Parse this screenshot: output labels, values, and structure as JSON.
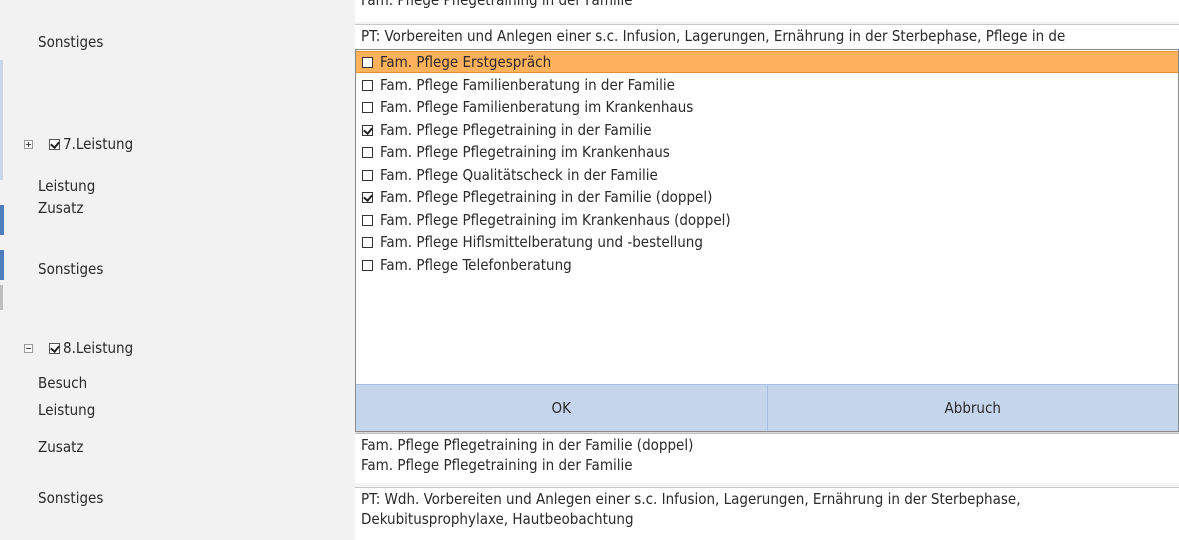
{
  "form": {
    "top_field_cut": "Fam. Pflege Pflegetraining in der Familie",
    "sonstiges_label": "Sonstiges",
    "sonstiges_prev_value": "PT: Vorbereiten und  Anlegen einer s.c. Infusion, Lagerungen, Ernährung in der Sterbephase, Pflege in de",
    "section7": {
      "title": "7.Leistung",
      "expander": "+",
      "checked": true,
      "leistung_label": "Leistung",
      "zusatz_label": "Zusatz",
      "sonstiges_label": "Sonstiges"
    },
    "section8": {
      "title": "8.Leistung",
      "expander": "-",
      "checked": true,
      "besuch_label": "Besuch",
      "leistung_label": "Leistung",
      "zusatz_label": "Zusatz",
      "zusatz_value_1": "Fam. Pflege Pflegetraining in der Familie (doppel)",
      "zusatz_value_2": "Fam. Pflege Pflegetraining in der Familie",
      "sonstiges_label": "Sonstiges",
      "sonstiges_value_1": "PT: Wdh. Vorbereiten und  Anlegen einer s.c. Infusion, Lagerungen, Ernährung in der Sterbephase,",
      "sonstiges_value_2": "Dekubitusprophylaxe, Hautbeobachtung"
    }
  },
  "popup": {
    "options": [
      {
        "label": "Fam. Pflege Erstgespräch",
        "checked": false,
        "highlighted": true
      },
      {
        "label": "Fam. Pflege Familienberatung in der Familie",
        "checked": false,
        "highlighted": false
      },
      {
        "label": "Fam. Pflege Familienberatung im Krankenhaus",
        "checked": false,
        "highlighted": false
      },
      {
        "label": "Fam. Pflege Pflegetraining in der Familie",
        "checked": true,
        "highlighted": false
      },
      {
        "label": "Fam. Pflege Pflegetraining im Krankenhaus",
        "checked": false,
        "highlighted": false
      },
      {
        "label": "Fam. Pflege Qualitätscheck in der Familie",
        "checked": false,
        "highlighted": false
      },
      {
        "label": "Fam. Pflege Pflegetraining in der Familie (doppel)",
        "checked": true,
        "highlighted": false
      },
      {
        "label": "Fam. Pflege Pflegetraining im Krankenhaus (doppel)",
        "checked": false,
        "highlighted": false
      },
      {
        "label": "Fam. Pflege Hiflsmittelberatung und -bestellung",
        "checked": false,
        "highlighted": false
      },
      {
        "label": "Fam. Pflege Telefonberatung",
        "checked": false,
        "highlighted": false
      }
    ],
    "ok_label": "OK",
    "cancel_label": "Abbruch"
  },
  "colors": {
    "highlight": "#ffb15c",
    "button_bar": "#c5d6ec",
    "left_accent": "#4e7ec0",
    "background": "#f2f2f2"
  }
}
